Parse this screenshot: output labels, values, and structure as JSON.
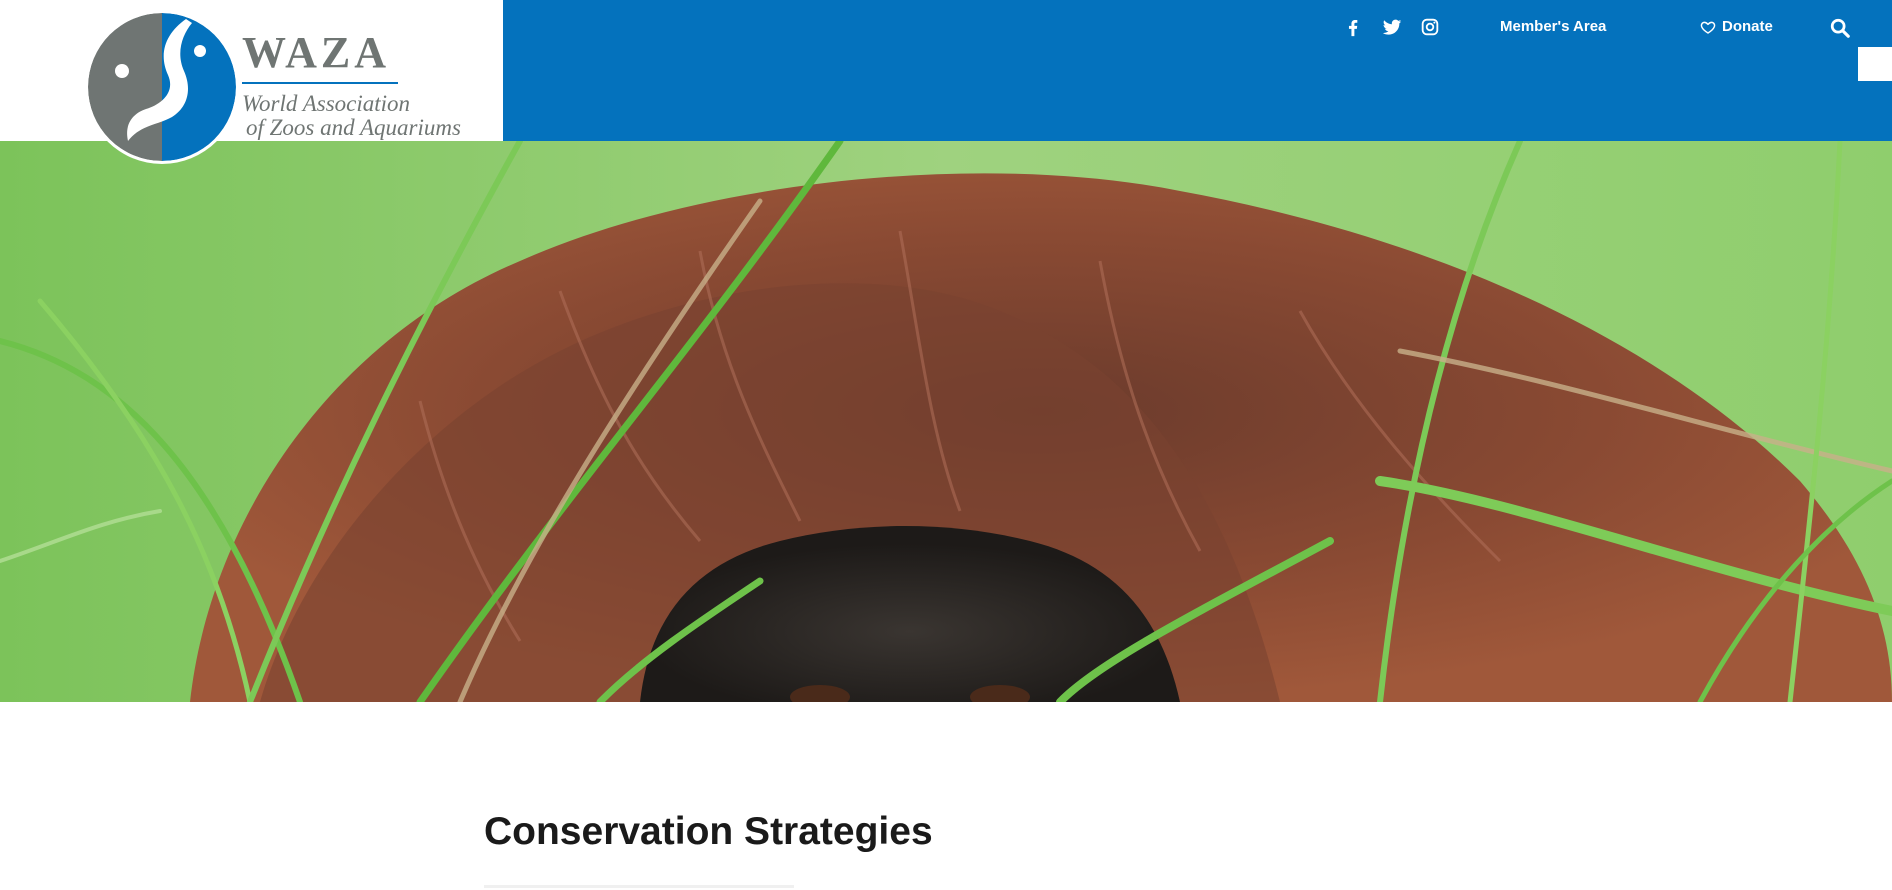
{
  "header": {
    "logo": {
      "word": "WAZA",
      "line1": "World Association",
      "line2": "of Zoos and Aquariums"
    },
    "social": [
      {
        "icon": "facebook-icon"
      },
      {
        "icon": "twitter-icon"
      },
      {
        "icon": "instagram-icon"
      }
    ],
    "members_label": "Member's Area",
    "donate_label": "Donate",
    "donate_icon": "heart-icon",
    "search_icon": "search-icon",
    "colors": {
      "topbar": "#0472bd",
      "logo_grey": "#6f7573"
    }
  },
  "hero": {
    "image": "orangutan-in-grass"
  },
  "main": {
    "title": "Conservation Strategies"
  }
}
